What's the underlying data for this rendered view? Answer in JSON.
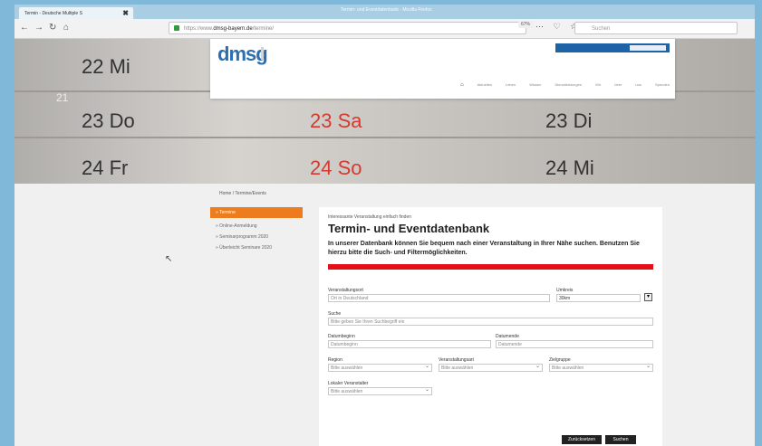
{
  "browser": {
    "tab_title": "Termin - Deutsche Multiple S",
    "tab_close": "✖",
    "window_title": "Termin- und Eventdatenbank - Mozilla Firefox",
    "url_prefix": "https://www.",
    "url_domain": "dmsg-bayern.de",
    "url_path": "/termine/",
    "zoom": "67%",
    "search_placeholder": "Suchen",
    "chrome_icons": "⋯ ♡ ☆"
  },
  "hero": {
    "calendar": [
      {
        "text": "22 Mi"
      },
      {
        "text": "21"
      },
      {
        "text": "23 Do"
      },
      {
        "text": "24 Fr"
      },
      {
        "text": "23 Sa"
      },
      {
        "text": "24 So"
      },
      {
        "text": "23 Di"
      },
      {
        "text": "24 Mi"
      }
    ]
  },
  "site": {
    "logo": "dmsg",
    "mainnav": [
      "Aktuelles",
      "Leben",
      "Wissen",
      "Dienstleistungen",
      "Wir über uns",
      "Spenden"
    ],
    "breadcrumb": "Home / Termine/Events",
    "sidebar_active": "» Termine",
    "sidebar_items": [
      "» Online-Anmeldung",
      "» Seminarprogramm 2020",
      "» Überleicht Seminare 2020"
    ]
  },
  "form": {
    "kicker": "Interessante Veranstaltung einfach finden",
    "title": "Termin- und Eventdatenbank",
    "intro": "In unserer Datenbank können Sie bequem nach einer Veranstaltung in Ihrer Nähe suchen. Benutzen Sie hierzu bitte die Such- und Filtermöglichkeiten.",
    "labels": {
      "location": "Veranstaltungsort",
      "radius": "Umkreis",
      "search": "Suche",
      "date_start": "Datumbeginn",
      "date_end": "Datumende",
      "region": "Region",
      "event_type": "Veranstaltungsart",
      "target": "Zielgruppe",
      "organizer": "Lokaler Veranstalter"
    },
    "values": {
      "location": "Ort in Deutschland",
      "radius": "30km",
      "search": "Bitte geben Sie Ihren Suchbegriff ein",
      "date_start": "Datumbeginn",
      "date_end": "Datumende",
      "region": "Bitte auswählen",
      "event_type": "Bitte auswählen",
      "target": "Bitte auswählen",
      "organizer": "Bitte auswählen"
    },
    "reset_label": "Zurücksetzen",
    "submit_label": "Suchen"
  },
  "colors": {
    "accent": "#ec7c1e",
    "brand": "#2c6fb0",
    "alert": "#e3101a"
  }
}
